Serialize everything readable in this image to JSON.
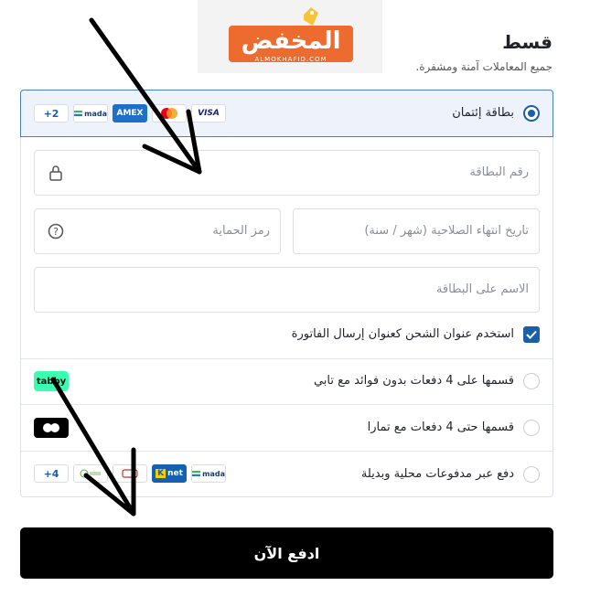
{
  "logo": {
    "text": "المخفض",
    "subtext": "ALMOKHAFID.COM",
    "colors": {
      "brand": "#ee6b2f",
      "tag": "#f6c33b"
    }
  },
  "header": {
    "title": "قسط",
    "subtitle": "جميع المعاملات آمنة ومشفرة."
  },
  "payment_options": [
    {
      "label": "بطاقة إئتمان",
      "selected": true,
      "badges": [
        "VISA",
        "mastercard",
        "AMEX",
        "mada",
        "+2"
      ]
    },
    {
      "label": "قسمها على 4 دفعات بدون فوائد مع تابي",
      "selected": false,
      "badges": [
        "tabby"
      ]
    },
    {
      "label": "قسمها حتى 4 دفعات مع تمارا",
      "selected": false,
      "badges": [
        "tamara"
      ]
    },
    {
      "label": "دفع عبر مدفوعات محلية وبديلة",
      "selected": false,
      "badges": [
        "mada",
        "knet",
        "stc",
        "umrah",
        "+4"
      ]
    }
  ],
  "card_form": {
    "card_number_placeholder": "رقم البطاقة",
    "expiry_placeholder": "تاريخ انتهاء الصلاحية (شهر / سنة)",
    "cvv_placeholder": "رمز الحماية",
    "name_placeholder": "الاسم على البطاقة",
    "billing_checkbox_label": "استخدم عنوان الشحن كعنوان إرسال الفاتورة",
    "billing_checked": true
  },
  "pay_button": {
    "label": "ادفع الآن"
  },
  "badge_text": {
    "visa": "VISA",
    "amex": "AMEX",
    "mada": "mada",
    "more2": "+2",
    "more4": "+4",
    "tabby": "tabby",
    "knet": "net"
  },
  "colors": {
    "accent": "#1a5fa8",
    "selected_bg": "#eef3fb",
    "button": "#000000",
    "tabby": "#3bffb0"
  }
}
